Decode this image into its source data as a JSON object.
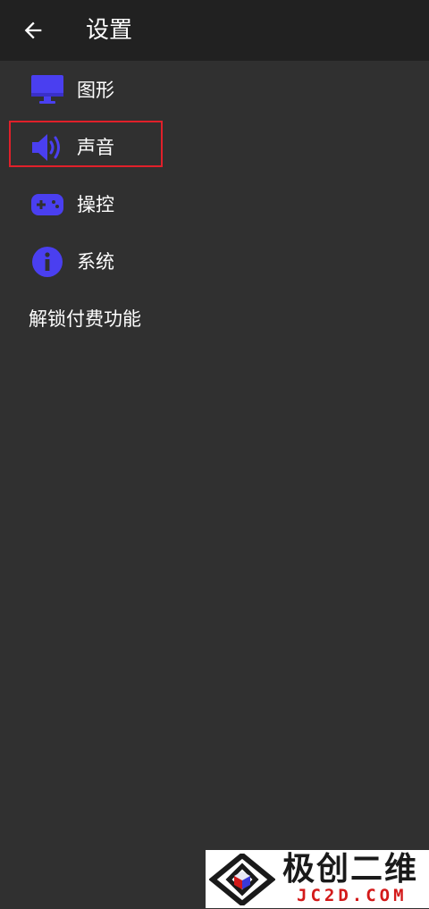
{
  "appbar": {
    "title": "设置",
    "back_icon": "arrow-back-icon"
  },
  "menu": {
    "items": [
      {
        "label": "图形",
        "icon": "monitor-icon"
      },
      {
        "label": "声音",
        "icon": "speaker-icon"
      },
      {
        "label": "操控",
        "icon": "gamepad-icon"
      },
      {
        "label": "系统",
        "icon": "info-icon"
      },
      {
        "label": "解锁付费功能",
        "icon": ""
      }
    ]
  },
  "colors": {
    "background": "#303030",
    "appbar": "#212121",
    "icon_accent": "#4a3ff0",
    "highlight_border": "#e0202a"
  },
  "watermark": {
    "title": "极创二维",
    "subtitle": "JC2D.COM"
  }
}
